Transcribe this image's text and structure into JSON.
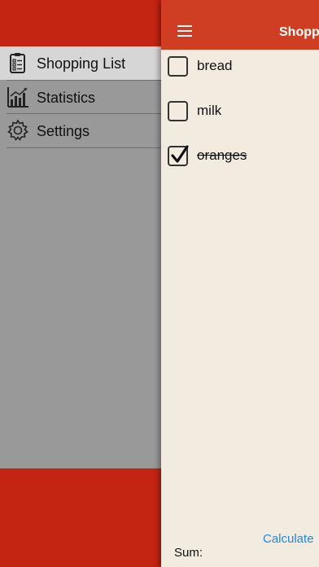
{
  "sidebar": {
    "items": [
      {
        "label": "Shopping List",
        "icon": "clipboard-list-icon",
        "active": true
      },
      {
        "label": "Statistics",
        "icon": "bar-chart-icon",
        "active": false
      },
      {
        "label": "Settings",
        "icon": "gear-icon",
        "active": false
      }
    ]
  },
  "header": {
    "title": "Shopping List",
    "menu_icon": "hamburger-icon"
  },
  "list": {
    "items": [
      {
        "label": "bread",
        "checked": false
      },
      {
        "label": "milk",
        "checked": false
      },
      {
        "label": "oranges",
        "checked": true
      }
    ]
  },
  "footer": {
    "sum_label": "Sum:",
    "calculate_label": "Calculate"
  },
  "colors": {
    "accent_red": "#c42412",
    "navbar_red": "#cf3e22",
    "menu_gray": "#999999",
    "content_bg": "#f2ece0",
    "link_blue": "#1e88e5"
  }
}
